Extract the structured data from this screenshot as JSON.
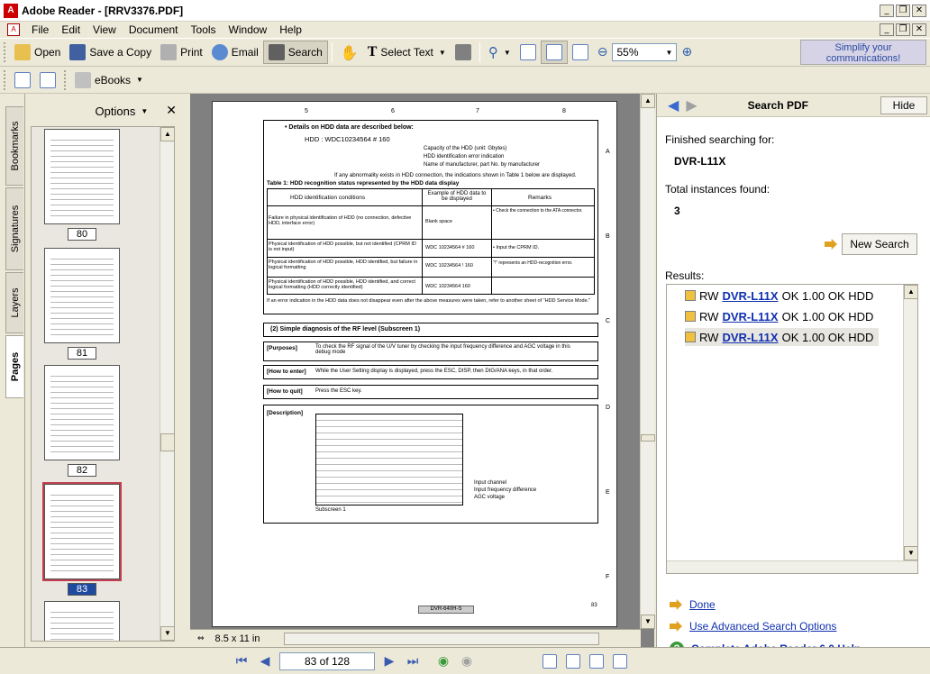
{
  "window": {
    "title": "Adobe Reader - [RRV3376.PDF]"
  },
  "menubar": {
    "items": [
      "File",
      "Edit",
      "View",
      "Document",
      "Tools",
      "Window",
      "Help"
    ]
  },
  "toolbar": {
    "open": "Open",
    "save_copy": "Save a Copy",
    "print": "Print",
    "email": "Email",
    "search": "Search",
    "select_text": "Select Text",
    "zoom": "55%",
    "ebooks": "eBooks",
    "ad_text": "Simplify your communications!"
  },
  "sidebar": {
    "tabs": [
      "Bookmarks",
      "Signatures",
      "Layers",
      "Pages"
    ],
    "options_label": "Options",
    "thumbnails": [
      {
        "label": "80"
      },
      {
        "label": "81"
      },
      {
        "label": "82"
      },
      {
        "label": "83"
      }
    ]
  },
  "document": {
    "page_size": "8.5 x 11 in",
    "col_markers": [
      "5",
      "6",
      "7",
      "8"
    ],
    "row_markers": [
      "A",
      "B",
      "C",
      "D",
      "E",
      "F"
    ],
    "hdd_title": "• Details on HDD data are described below:",
    "hdd_line": "HDD  :  WDC10234564  # 160",
    "hdd_notes": [
      "Capacity of the HDD (unit: Gbytes)",
      "HDD identification error indication",
      "Name of manufacturer, part No. by manufacturer"
    ],
    "abnormal": "If any abnormality exists in HDD connection, the indications shown in Table 1 below are displayed.",
    "table_title": "Table 1: HDD recognition status represented by the HDD data display",
    "table_headers": [
      "HDD identification conditions",
      "Example of HDD data to be displayed",
      "Remarks"
    ],
    "table_rows": [
      [
        "Failure in physical identification of HDD (no connection, defective HDD, interface error)",
        "Blank space",
        "• Check the connection to the ATA connector."
      ],
      [
        "Physical identification of HDD possible, but not identified (CPRM ID is not input)",
        "WDC 10234564 # 160",
        "• Input the CPRM ID."
      ],
      [
        "Physical identification of HDD possible, HDD identified, but failure in logical formatting",
        "WDC 10234564 ! 160",
        "\"!\" represents an HDD-recognition error."
      ],
      [
        "Physical identification of HDD possible, HDD identified, and correct logical formatting (HDD correctly identified)",
        "WDC 10234564   160",
        ""
      ]
    ],
    "error_note": "If an error indication in the HDD data does not disappear even after the above measures were taken, refer to another sheet of \"HDD Service Mode.\"",
    "section2": "(2) Simple diagnosis of the RF level (Subscreen 1)",
    "purposes_label": "[Purposes]",
    "purposes": "To check the RF signal of the U/V tuner by checking the input frequency difference and AGC voltage in this debug mode",
    "enter_label": "[How to enter]",
    "enter": "While the User Setting display is displayed, press the ESC, DISP, then DIG/ANA keys, in that order.",
    "quit_label": "[How to quit]",
    "quit": "Press the ESC key.",
    "desc_label": "[Description]",
    "subscreen": "Subscreen 1",
    "screen_labels": [
      "Input channel",
      "Input frequency difference",
      "AGC voltage"
    ],
    "footer_model": "DVR-640H-S",
    "page_number": "83"
  },
  "search": {
    "title": "Search PDF",
    "hide": "Hide",
    "finished_label": "Finished searching for:",
    "query": "DVR-L11X",
    "total_label": "Total instances found:",
    "total": "3",
    "new_search": "New Search",
    "results_label": "Results:",
    "results": [
      {
        "prefix": "RW",
        "match": "DVR-L11X",
        "suffix": "OK 1.00 OK HDD"
      },
      {
        "prefix": "RW",
        "match": "DVR-L11X",
        "suffix": "OK 1.00 OK HDD"
      },
      {
        "prefix": "RW",
        "match": "DVR-L11X",
        "suffix": "OK 1.00 OK HDD"
      }
    ],
    "done": "Done",
    "advanced": "Use Advanced Search Options",
    "help": "Complete Adobe Reader 6.0 Help"
  },
  "status": {
    "page_field": "83 of 128"
  },
  "colors": {
    "link": "#1030b0",
    "selection": "#1e4aa0",
    "accent": "#e0a020"
  }
}
